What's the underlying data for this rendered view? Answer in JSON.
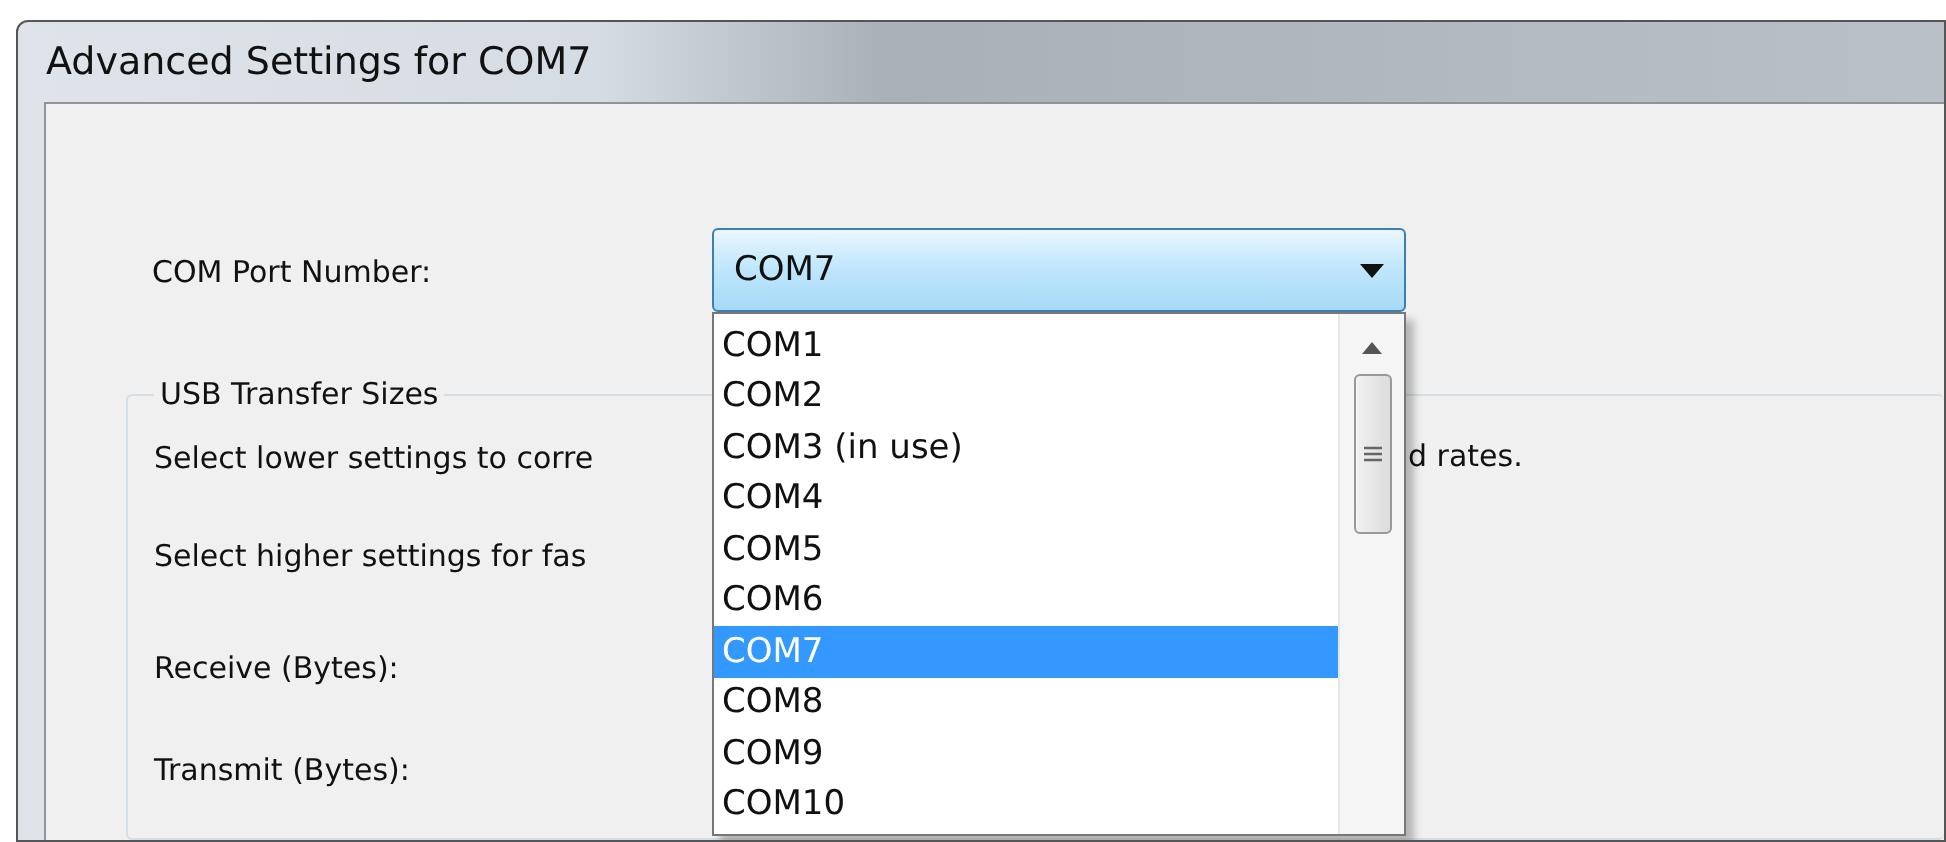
{
  "window": {
    "title": "Advanced Settings for COM7"
  },
  "com_port": {
    "label": "COM Port Number:",
    "value": "COM7",
    "expanded": true,
    "options": [
      {
        "label": "COM1",
        "selected": false
      },
      {
        "label": "COM2",
        "selected": false
      },
      {
        "label": "COM3 (in use)",
        "selected": false
      },
      {
        "label": "COM4",
        "selected": false
      },
      {
        "label": "COM5",
        "selected": false
      },
      {
        "label": "COM6",
        "selected": false
      },
      {
        "label": "COM7",
        "selected": true
      },
      {
        "label": "COM8",
        "selected": false
      },
      {
        "label": "COM9",
        "selected": false
      },
      {
        "label": "COM10",
        "selected": false
      }
    ]
  },
  "group": {
    "title": "USB Transfer Sizes",
    "lines": [
      {
        "left": "Select lower settings to corre",
        "right": "d rates."
      },
      {
        "left": "Select higher settings for fas"
      }
    ],
    "fields": [
      {
        "label": "Receive (Bytes):"
      },
      {
        "label": "Transmit (Bytes):"
      }
    ]
  }
}
